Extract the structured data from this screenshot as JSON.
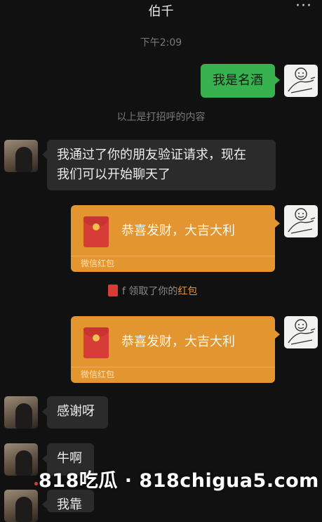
{
  "header": {
    "title": "伯千",
    "more_icon": "···"
  },
  "timestamp": "下午2:09",
  "system": {
    "greeting_note": "以上是打招呼的内容"
  },
  "messages": {
    "sent_1": "我是名酒",
    "recv_1_line1": "我通过了你的朋友验证请求，现在",
    "recv_1_line2": "我们可以开始聊天了",
    "recv_2": "感谢呀",
    "recv_3": "牛啊",
    "recv_4": "我靠"
  },
  "red_packets": [
    {
      "greeting": "恭喜发财，大吉大利",
      "label": "微信红包"
    },
    {
      "greeting": "恭喜发财，大吉大利",
      "label": "微信红包"
    }
  ],
  "packet_notice": {
    "prefix": "f 领取了你的",
    "highlight": "红包"
  },
  "watermark": "818吃瓜 · 818chigua5.com",
  "colors": {
    "background": "#111111",
    "sent_bubble": "#37b24f",
    "received_bubble": "#2b2b2b",
    "red_packet": "#e3952f",
    "highlight": "#e0953a"
  }
}
